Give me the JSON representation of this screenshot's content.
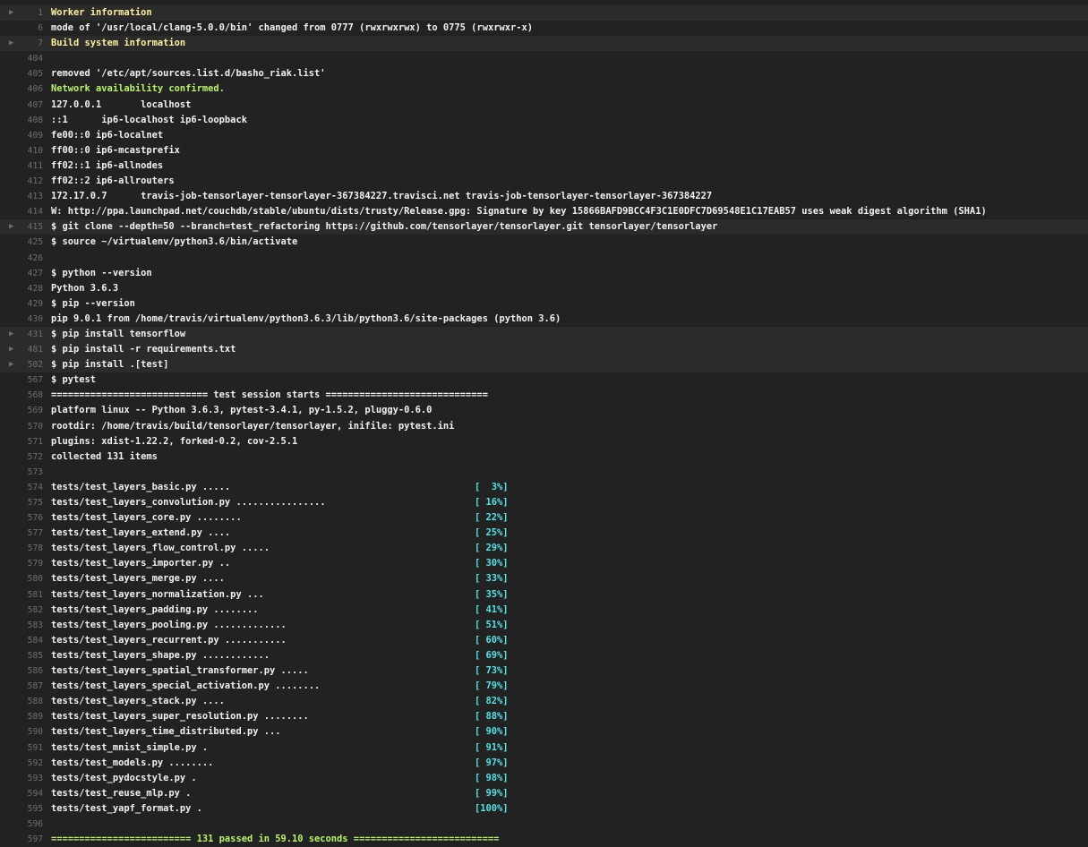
{
  "log": {
    "lines": [
      {
        "n": "1",
        "t": "Worker information",
        "cls": "hl-yellow",
        "fold": true
      },
      {
        "n": "6",
        "t": "mode of '/usr/local/clang-5.0.0/bin' changed from 0777 (rwxrwxrwx) to 0775 (rwxrwxr-x)"
      },
      {
        "n": "7",
        "t": "Build system information",
        "cls": "hl-yellow",
        "fold": true
      },
      {
        "n": "404",
        "t": ""
      },
      {
        "n": "405",
        "t": "removed '/etc/apt/sources.list.d/basho_riak.list'"
      },
      {
        "n": "406",
        "t": "Network availability confirmed.",
        "cls": "hl-green"
      },
      {
        "n": "407",
        "t": "127.0.0.1       localhost"
      },
      {
        "n": "408",
        "t": "::1      ip6-localhost ip6-loopback"
      },
      {
        "n": "409",
        "t": "fe00::0 ip6-localnet"
      },
      {
        "n": "410",
        "t": "ff00::0 ip6-mcastprefix"
      },
      {
        "n": "411",
        "t": "ff02::1 ip6-allnodes"
      },
      {
        "n": "412",
        "t": "ff02::2 ip6-allrouters"
      },
      {
        "n": "413",
        "t": "172.17.0.7      travis-job-tensorlayer-tensorlayer-367384227.travisci.net travis-job-tensorlayer-tensorlayer-367384227"
      },
      {
        "n": "414",
        "t": "W: http://ppa.launchpad.net/couchdb/stable/ubuntu/dists/trusty/Release.gpg: Signature by key 15866BAFD9BCC4F3C1E0DFC7D69548E1C17EAB57 uses weak digest algorithm (SHA1)"
      },
      {
        "n": "415",
        "t": "$ git clone --depth=50 --branch=test_refactoring https://github.com/tensorlayer/tensorlayer.git tensorlayer/tensorlayer",
        "fold": true
      },
      {
        "n": "425",
        "t": "$ source ~/virtualenv/python3.6/bin/activate"
      },
      {
        "n": "426",
        "t": ""
      },
      {
        "n": "427",
        "t": "$ python --version"
      },
      {
        "n": "428",
        "t": "Python 3.6.3"
      },
      {
        "n": "429",
        "t": "$ pip --version"
      },
      {
        "n": "430",
        "t": "pip 9.0.1 from /home/travis/virtualenv/python3.6.3/lib/python3.6/site-packages (python 3.6)"
      },
      {
        "n": "431",
        "t": "$ pip install tensorflow",
        "fold": true
      },
      {
        "n": "481",
        "t": "$ pip install -r requirements.txt",
        "fold": true
      },
      {
        "n": "502",
        "t": "$ pip install .[test]",
        "fold": true
      },
      {
        "n": "567",
        "t": "$ pytest"
      },
      {
        "n": "568",
        "t": "============================ test session starts ============================="
      },
      {
        "n": "569",
        "t": "platform linux -- Python 3.6.3, pytest-3.4.1, py-1.5.2, pluggy-0.6.0"
      },
      {
        "n": "570",
        "t": "rootdir: /home/travis/build/tensorlayer/tensorlayer, inifile: pytest.ini"
      },
      {
        "n": "571",
        "t": "plugins: xdist-1.22.2, forked-0.2, cov-2.5.1"
      },
      {
        "n": "572",
        "t": "collected 131 items"
      },
      {
        "n": "573",
        "t": ""
      },
      {
        "n": "574",
        "t": "tests/test_layers_basic.py .....",
        "p": "[  3%]"
      },
      {
        "n": "575",
        "t": "tests/test_layers_convolution.py ................",
        "p": "[ 16%]"
      },
      {
        "n": "576",
        "t": "tests/test_layers_core.py ........",
        "p": "[ 22%]"
      },
      {
        "n": "577",
        "t": "tests/test_layers_extend.py ....",
        "p": "[ 25%]"
      },
      {
        "n": "578",
        "t": "tests/test_layers_flow_control.py .....",
        "p": "[ 29%]"
      },
      {
        "n": "579",
        "t": "tests/test_layers_importer.py ..",
        "p": "[ 30%]"
      },
      {
        "n": "580",
        "t": "tests/test_layers_merge.py ....",
        "p": "[ 33%]"
      },
      {
        "n": "581",
        "t": "tests/test_layers_normalization.py ...",
        "p": "[ 35%]"
      },
      {
        "n": "582",
        "t": "tests/test_layers_padding.py ........",
        "p": "[ 41%]"
      },
      {
        "n": "583",
        "t": "tests/test_layers_pooling.py .............",
        "p": "[ 51%]"
      },
      {
        "n": "584",
        "t": "tests/test_layers_recurrent.py ...........",
        "p": "[ 60%]"
      },
      {
        "n": "585",
        "t": "tests/test_layers_shape.py ............",
        "p": "[ 69%]"
      },
      {
        "n": "586",
        "t": "tests/test_layers_spatial_transformer.py .....",
        "p": "[ 73%]"
      },
      {
        "n": "587",
        "t": "tests/test_layers_special_activation.py ........",
        "p": "[ 79%]"
      },
      {
        "n": "588",
        "t": "tests/test_layers_stack.py ....",
        "p": "[ 82%]"
      },
      {
        "n": "589",
        "t": "tests/test_layers_super_resolution.py ........",
        "p": "[ 88%]"
      },
      {
        "n": "590",
        "t": "tests/test_layers_time_distributed.py ...",
        "p": "[ 90%]"
      },
      {
        "n": "591",
        "t": "tests/test_mnist_simple.py .",
        "p": "[ 91%]"
      },
      {
        "n": "592",
        "t": "tests/test_models.py ........",
        "p": "[ 97%]"
      },
      {
        "n": "593",
        "t": "tests/test_pydocstyle.py .",
        "p": "[ 98%]"
      },
      {
        "n": "594",
        "t": "tests/test_reuse_mlp.py .",
        "p": "[ 99%]"
      },
      {
        "n": "595",
        "t": "tests/test_yapf_format.py .",
        "p": "[100%]"
      },
      {
        "n": "596",
        "t": ""
      },
      {
        "n": "597",
        "t": "========================= 131 passed in 59.10 seconds ==========================",
        "cls": "hl-green"
      }
    ]
  },
  "colors": {
    "background": "#222222",
    "fold_background": "#2b2b2b",
    "text": "#f1f1f1",
    "line_number": "#6f6f6f",
    "yellow": "#fff09b",
    "green": "#b8f26f",
    "percent": "#56e3e8"
  },
  "icons": {
    "fold": "triangle-right-icon"
  }
}
